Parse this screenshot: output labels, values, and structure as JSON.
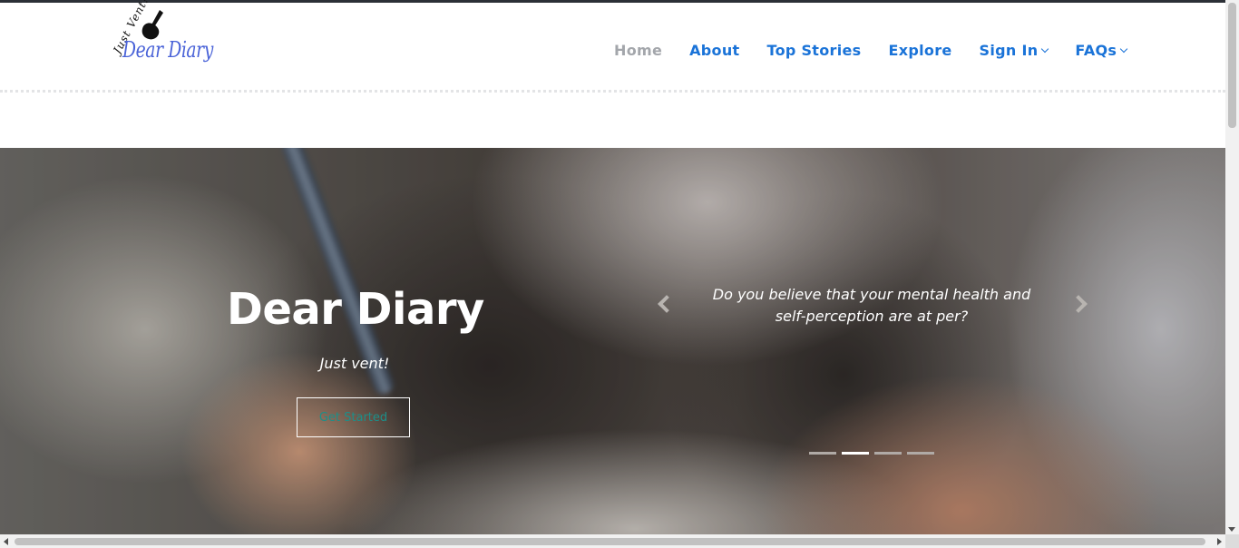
{
  "logo": {
    "text": "Dear Diary",
    "tagline": "Just Vent!",
    "icon": "hand-writing-icon"
  },
  "nav": {
    "items": [
      {
        "label": "Home",
        "active": true
      },
      {
        "label": "About"
      },
      {
        "label": "Top Stories"
      },
      {
        "label": "Explore"
      },
      {
        "label": "Sign In",
        "dropdown": true
      },
      {
        "label": "FAQs",
        "dropdown": true
      }
    ]
  },
  "hero": {
    "title": "Dear Diary",
    "subtitle": "Just vent!",
    "cta_label": "Get Started",
    "quote": "Do you believe that your mental health and self-perception are at per?",
    "slide_count": 4,
    "active_slide": 2
  },
  "colors": {
    "nav_link": "#1a73d8",
    "nav_active": "#a3a6ab",
    "cta_text": "#1c8f89",
    "logo": "#4a63d8"
  }
}
